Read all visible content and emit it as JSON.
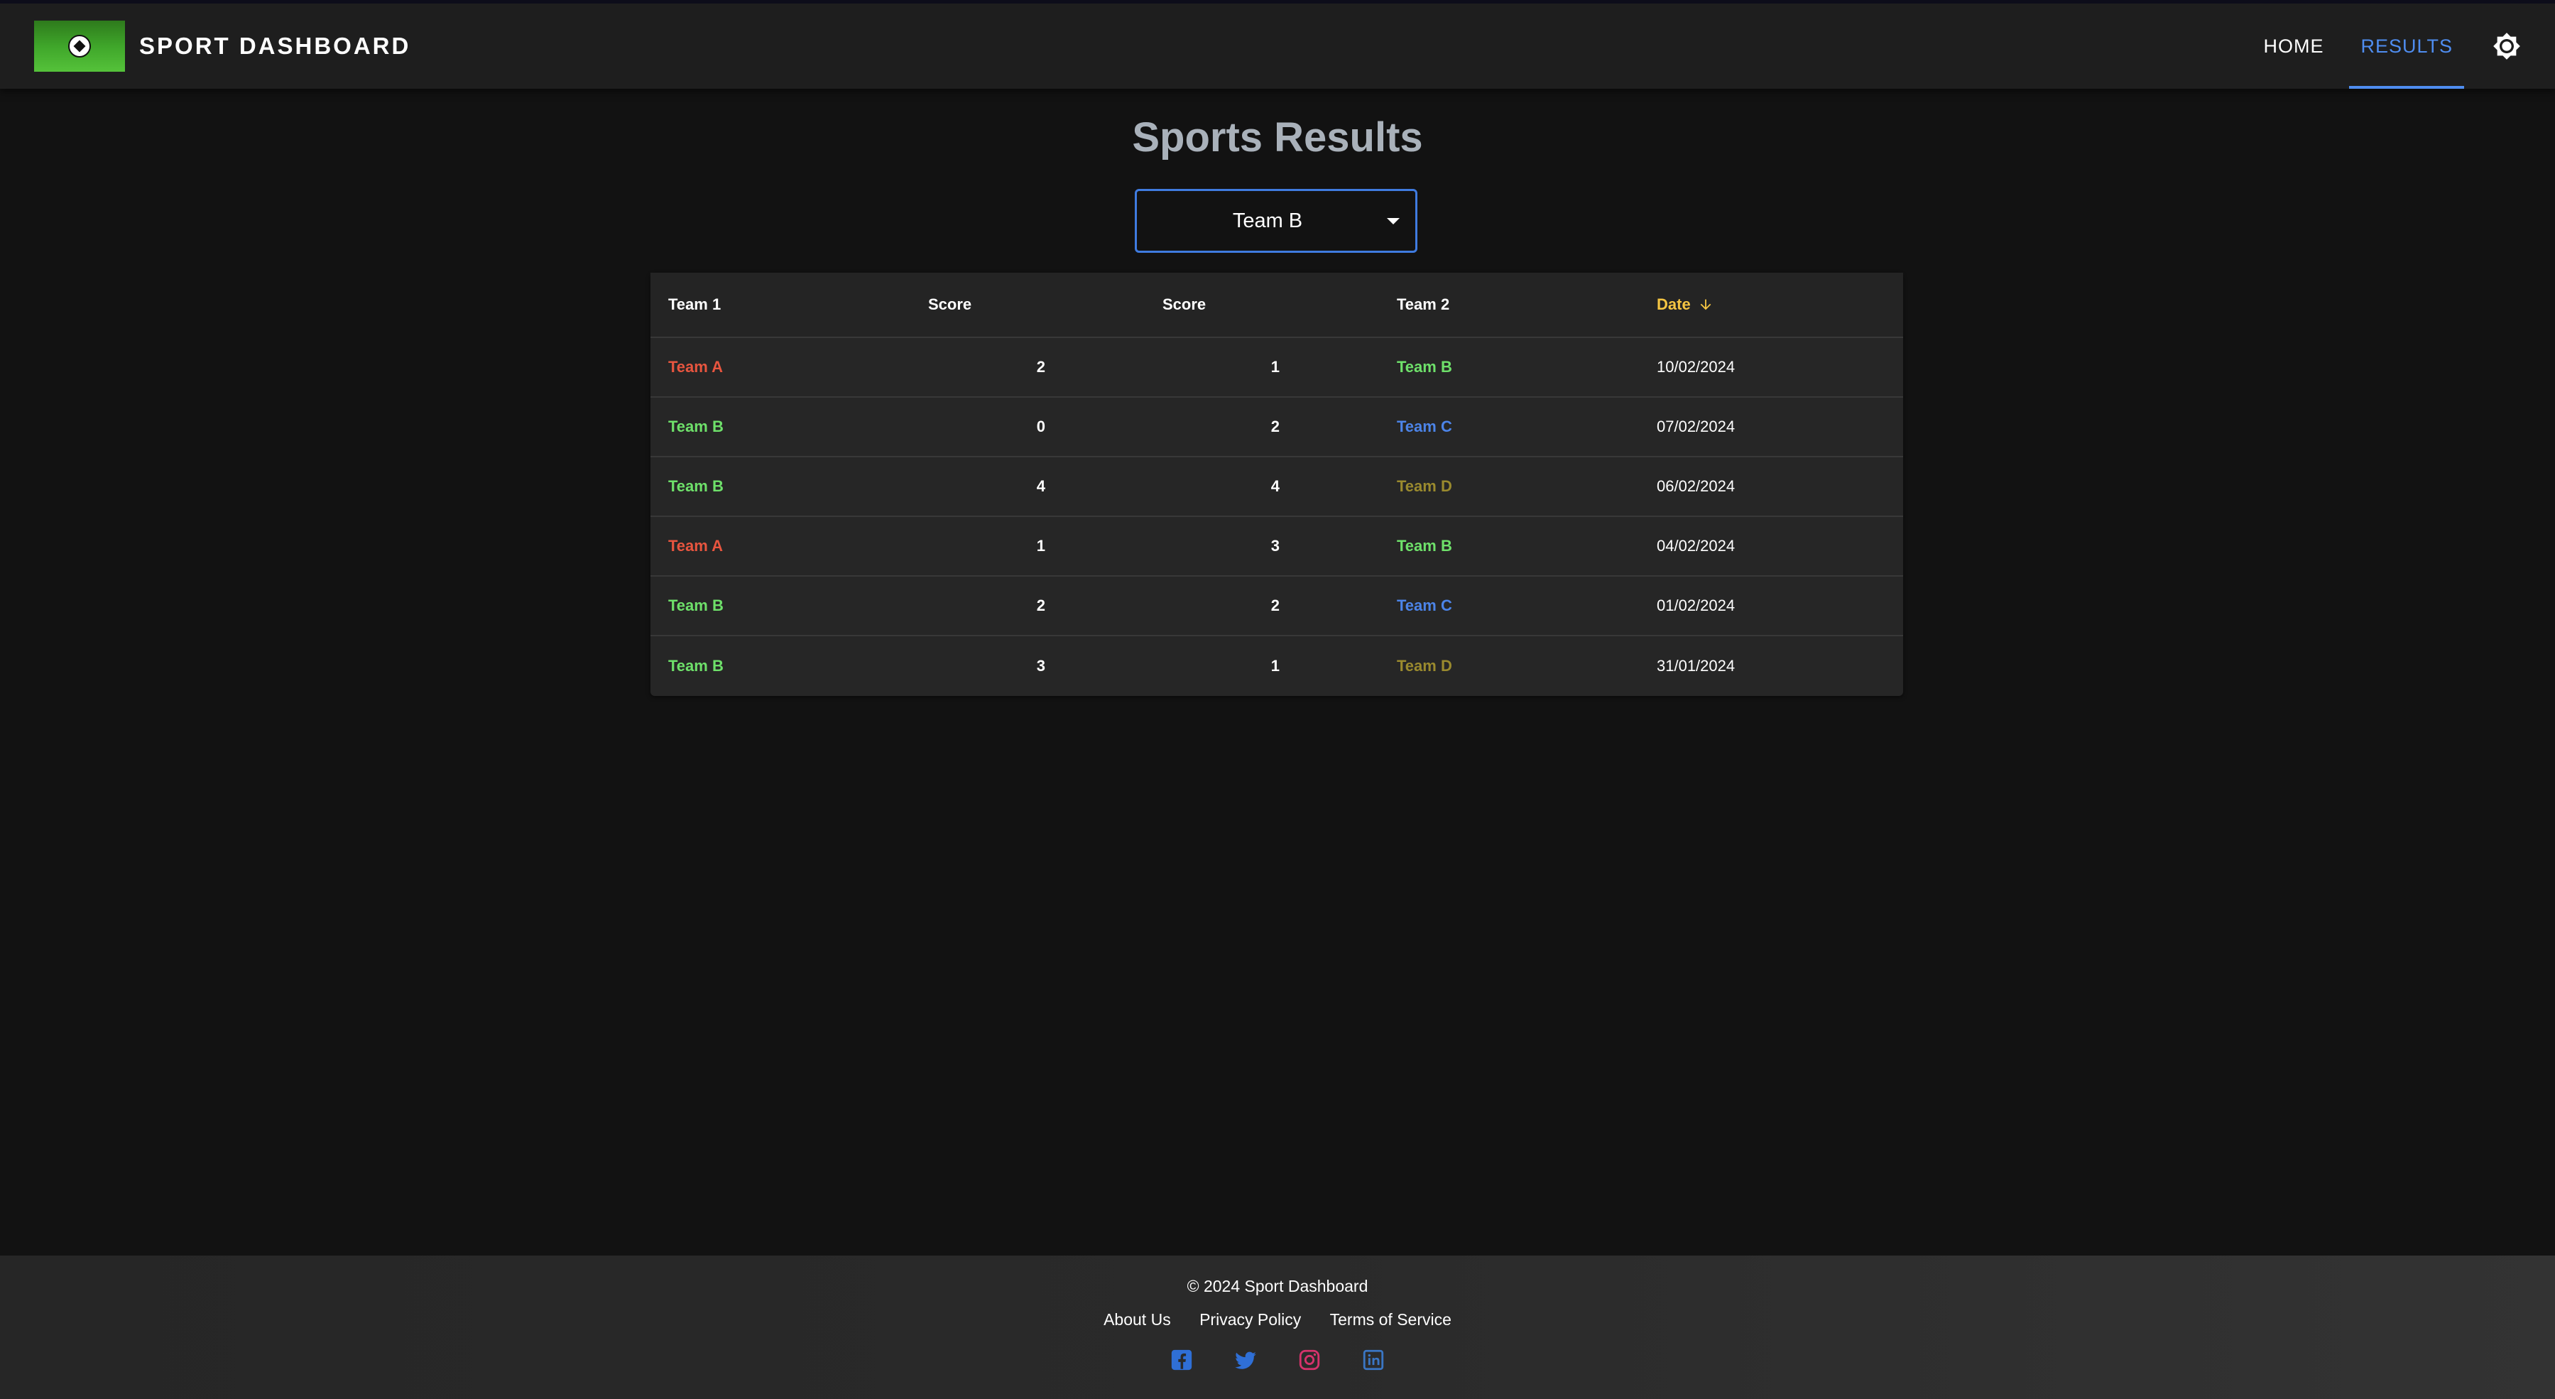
{
  "header": {
    "brand": "SPORT DASHBOARD",
    "nav": [
      {
        "label": "HOME",
        "active": false
      },
      {
        "label": "RESULTS",
        "active": true
      }
    ],
    "logo_icon": "soccer-field-icon",
    "theme_toggle_icon": "brightness-icon"
  },
  "page": {
    "title": "Sports Results"
  },
  "filter": {
    "selected": "Team B"
  },
  "table": {
    "columns": [
      "Team 1",
      "Score",
      "Score",
      "Team 2",
      "Date"
    ],
    "sort": {
      "column": "Date",
      "direction": "descending"
    },
    "rows": [
      {
        "team1": "Team A",
        "score1": "2",
        "score2": "1",
        "team2": "Team B",
        "date": "10/02/2024"
      },
      {
        "team1": "Team B",
        "score1": "0",
        "score2": "2",
        "team2": "Team C",
        "date": "07/02/2024"
      },
      {
        "team1": "Team B",
        "score1": "4",
        "score2": "4",
        "team2": "Team D",
        "date": "06/02/2024"
      },
      {
        "team1": "Team A",
        "score1": "1",
        "score2": "3",
        "team2": "Team B",
        "date": "04/02/2024"
      },
      {
        "team1": "Team B",
        "score1": "2",
        "score2": "2",
        "team2": "Team C",
        "date": "01/02/2024"
      },
      {
        "team1": "Team B",
        "score1": "3",
        "score2": "1",
        "team2": "Team D",
        "date": "31/01/2024"
      }
    ]
  },
  "team_colors": {
    "Team A": "#e8553f",
    "Team B": "#6ee06a",
    "Team C": "#4c84e8",
    "Team D": "#9a8a2e"
  },
  "footer": {
    "copyright": "© 2024 Sport Dashboard",
    "links": [
      "About Us",
      "Privacy Policy",
      "Terms of Service"
    ],
    "socials": [
      "facebook-icon",
      "twitter-icon",
      "instagram-icon",
      "linkedin-icon"
    ]
  },
  "colors": {
    "accent": "#4f8df0",
    "sort_highlight": "#f5c542",
    "background": "#121212"
  }
}
